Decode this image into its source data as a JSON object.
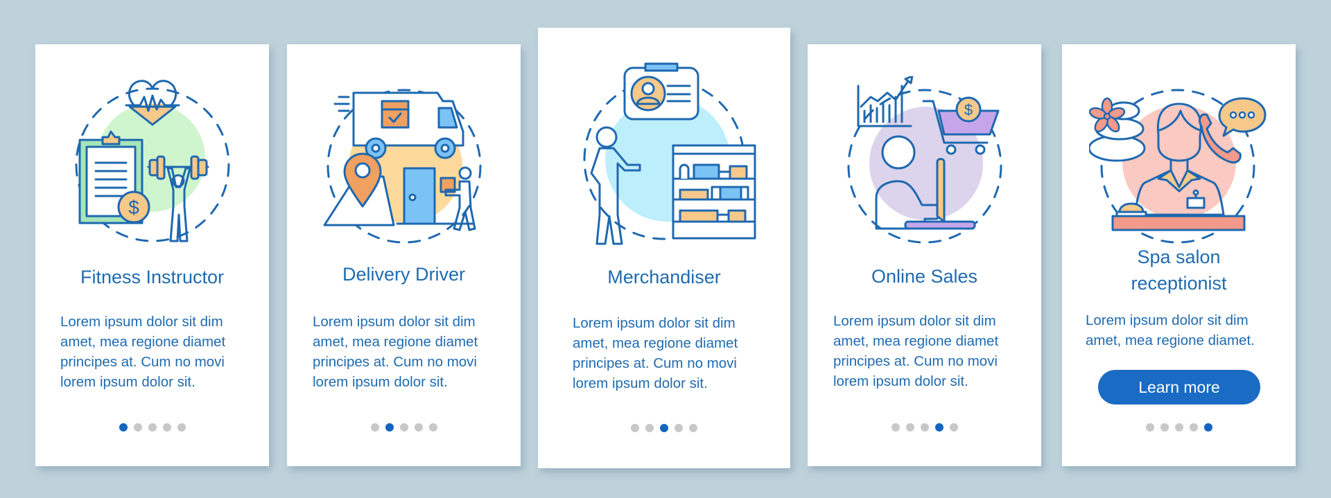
{
  "colors": {
    "background": "#bed2dc",
    "card": "#ffffff",
    "text": "#1f6bb0",
    "accent": "#1565c0",
    "dot_inactive": "#c8c8c8",
    "button": "#1a6bc4"
  },
  "cards": [
    {
      "title": "Fitness Instructor",
      "body": "Lorem ipsum dolor sit dim\namet, mea regione diamet\nprincipes at. Cum no movi\nlorem ipsum dolor sit.",
      "icon": "fitness-instructor-illustration",
      "page_index": 1,
      "page_count": 5
    },
    {
      "title": "Delivery Driver",
      "body": "Lorem ipsum dolor sit dim\namet, mea regione diamet\nprincipes at. Cum no movi\nlorem ipsum dolor sit.",
      "icon": "delivery-driver-illustration",
      "page_index": 2,
      "page_count": 5
    },
    {
      "title": "Merchandiser",
      "body": "Lorem ipsum dolor sit dim\namet, mea regione diamet\nprincipes at. Cum no movi\nlorem ipsum dolor sit.",
      "icon": "merchandiser-illustration",
      "page_index": 3,
      "page_count": 5
    },
    {
      "title": "Online Sales",
      "body": "Lorem ipsum dolor sit dim\namet, mea regione diamet\nprincipes at. Cum no movi\nlorem ipsum dolor sit.",
      "icon": "online-sales-illustration",
      "page_index": 4,
      "page_count": 5
    },
    {
      "title": "Spa salon\nreceptionist",
      "title_line1": "Spa salon",
      "title_line2": "receptionist",
      "body": "Lorem ipsum dolor sit dim\namet, mea regione diamet.",
      "icon": "spa-receptionist-illustration",
      "button_label": "Learn more",
      "page_index": 5,
      "page_count": 5
    }
  ]
}
